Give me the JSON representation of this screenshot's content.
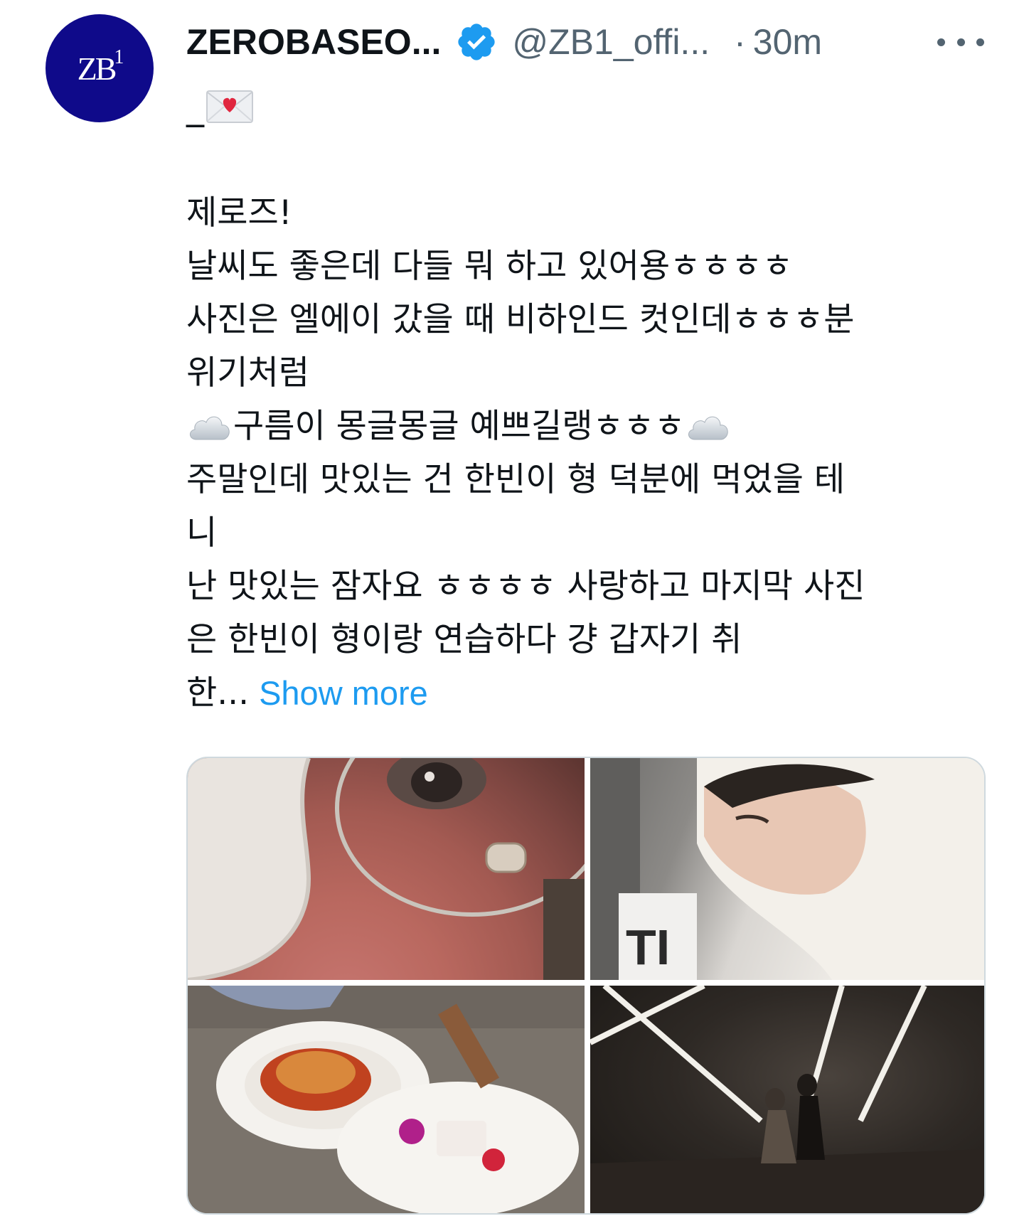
{
  "tweet": {
    "display_name": "ZEROBASEO...",
    "handle": "@ZB1_offi...",
    "separator": "·",
    "time": "30m",
    "avatar_text": "ZB1",
    "first_line": "_",
    "body_lines": [
      "제로즈!",
      "날씨도 좋은데 다들 뭐 하고 있어용ㅎㅎㅎㅎ",
      "사진은 엘에이 갔을 때 비하인드 컷인데ㅎㅎㅎ분",
      "위기처럼",
      "구름이 몽글몽글 예쁘길랭ㅎㅎㅎ",
      "주말인데 맛있는 건 한빈이 형 덕분에 먹었을 테",
      "니",
      "난 맛있는 잠자요 ㅎㅎㅎㅎ 사랑하고 마지막 사진",
      "은 한빈이 형이랑 연습하다 걍 갑자기 취",
      "한..."
    ],
    "show_more": "Show more",
    "icons": {
      "verified": "verified-badge-icon",
      "more": "more-options-icon",
      "envelope": "love-letter-icon",
      "cloud": "cloud-icon"
    },
    "colors": {
      "avatar_bg": "#0f0a8a",
      "verified": "#1d9bf0",
      "link": "#1d9bf0",
      "secondary_text": "#536471"
    }
  }
}
